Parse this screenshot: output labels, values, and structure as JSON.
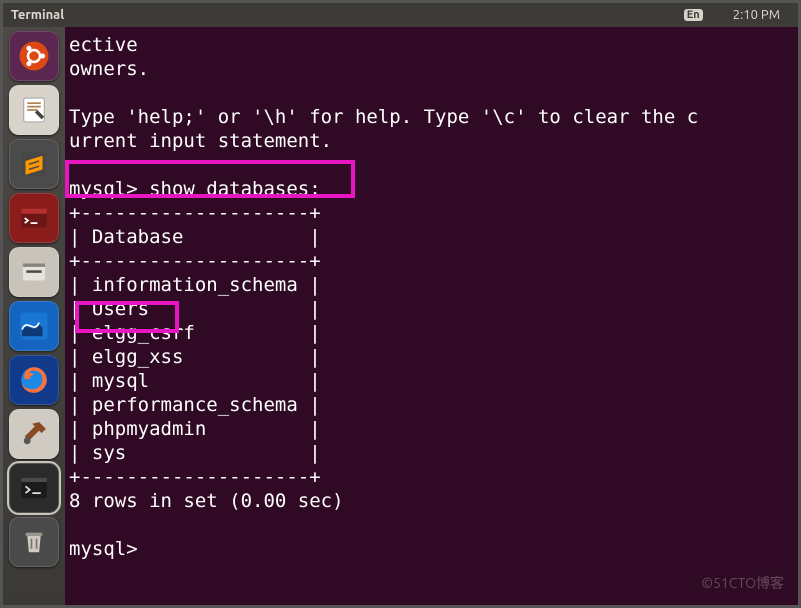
{
  "topbar": {
    "title": "Terminal",
    "lang_badge": "En",
    "clock": "2:10 PM"
  },
  "launcher": {
    "items": [
      "ubuntu-icon",
      "text-editor-icon",
      "sublime-icon",
      "terminal-red-icon",
      "files-icon",
      "wireshark-icon",
      "firefox-icon",
      "settings-tool-icon",
      "terminal-icon",
      "trash-icon"
    ]
  },
  "terminal": {
    "lines": [
      "ective",
      "owners.",
      "",
      "Type 'help;' or '\\h' for help. Type '\\c' to clear the c",
      "urrent input statement.",
      "",
      "mysql> show databases;",
      "+--------------------+",
      "| Database           |",
      "+--------------------+",
      "| information_schema |",
      "| Users              |",
      "| elgg_csrf          |",
      "| elgg_xss           |",
      "| mysql              |",
      "| performance_schema |",
      "| phpmyadmin         |",
      "| sys                |",
      "+--------------------+",
      "8 rows in set (0.00 sec)",
      "",
      "mysql>"
    ],
    "highlight_command_index": 6,
    "highlight_row_index": 11
  },
  "watermark": "©51CTO博客",
  "colors": {
    "terminal_bg": "#300a24",
    "highlight": "#e815c3",
    "panel": "#3c3b37"
  }
}
